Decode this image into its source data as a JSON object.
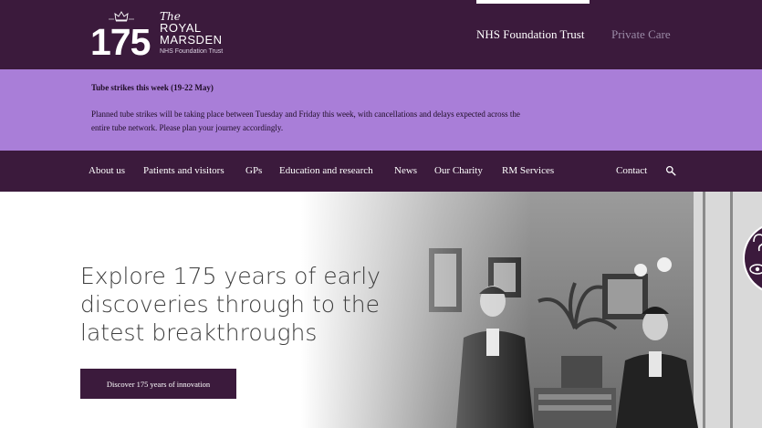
{
  "header": {
    "logo": {
      "number": "175",
      "the": "The",
      "royal": "ROYAL",
      "marsden": "MARSDEN",
      "subtitle": "NHS Foundation Trust"
    },
    "links": {
      "nhs": "NHS Foundation Trust",
      "private": "Private Care"
    }
  },
  "alert": {
    "title": "Tube strikes this week (19-22 May)",
    "body": "Planned tube strikes will be taking place between Tuesday and Friday this week, with cancellations and delays expected across the entire tube network. Please plan your journey accordingly."
  },
  "nav": {
    "items": [
      "About us",
      "Patients and visitors",
      "GPs",
      "Education and research",
      "News",
      "Our Charity",
      "RM Services"
    ],
    "contact": "Contact",
    "search_icon": "search-icon"
  },
  "hero": {
    "title": "Explore 175 years of early discoveries through to the latest breakthroughs",
    "cta": "Discover 175 years of innovation",
    "image": "historic black-and-white photograph of two men in a ward with plants"
  },
  "colors": {
    "brand_purple": "#3b1a3c",
    "alert_lilac": "#a97ed8",
    "muted_link": "#9a8aa6"
  }
}
